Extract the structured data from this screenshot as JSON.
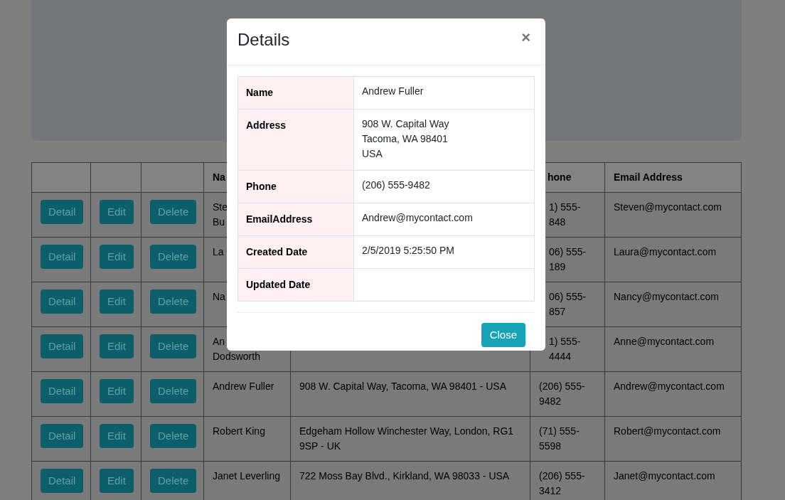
{
  "table": {
    "header": {
      "name": "Na",
      "phone": "hone",
      "email": "Email Address"
    },
    "rows": [
      {
        "kind": "partly_covered",
        "buttons": [
          "Detail",
          "Edit",
          "Delete"
        ],
        "name": "Ste\nBu",
        "phone": "1) 555-\n848",
        "email": "Steven@mycontact.com"
      },
      {
        "kind": "partly_covered",
        "buttons": [
          "Detail",
          "Edit",
          "Delete"
        ],
        "name": "La",
        "phone": "06) 555-\n189",
        "email": "Laura@mycontact.com"
      },
      {
        "kind": "partly_covered",
        "buttons": [
          "Detail",
          "Edit",
          "Delete"
        ],
        "name": "Na",
        "phone": "06) 555-\n857",
        "email": "Nancy@mycontact.com"
      },
      {
        "kind": "partly_covered",
        "buttons": [
          "Detail",
          "Edit",
          "Delete"
        ],
        "name": "An\nDodsworth",
        "phone": "1) 555-\n4444",
        "email": "Anne@mycontact.com"
      },
      {
        "kind": "full",
        "buttons": [
          "Detail",
          "Edit",
          "Delete"
        ],
        "name": "Andrew Fuller",
        "address": "908 W. Capital Way, Tacoma, WA 98401 - USA",
        "phone": "(206) 555-9482",
        "email": "Andrew@mycontact.com"
      },
      {
        "kind": "full",
        "buttons": [
          "Detail",
          "Edit",
          "Delete"
        ],
        "name": "Robert King",
        "address": "Edgeham Hollow Winchester Way, London, RG1 9SP - UK",
        "phone": "(71) 555-5598",
        "email": "Robert@mycontact.com"
      },
      {
        "kind": "full",
        "buttons": [
          "Detail",
          "Edit",
          "Delete"
        ],
        "name": "Janet Leverling",
        "address": "722 Moss Bay Blvd., Kirkland, WA 98033 - USA",
        "phone": "(206) 555-3412",
        "email": "Janet@mycontact.com"
      }
    ]
  },
  "modal": {
    "title": "Details",
    "close_icon": "×",
    "fields": [
      {
        "label": "Name",
        "value": "Andrew Fuller"
      },
      {
        "label": "Address",
        "value": "908 W. Capital Way\nTacoma, WA 98401\nUSA"
      },
      {
        "label": "Phone",
        "value": "(206) 555-9482"
      },
      {
        "label": "EmailAddress",
        "value": "Andrew@mycontact.com"
      },
      {
        "label": "Created Date",
        "value": "2/5/2019 5:25:50 PM"
      },
      {
        "label": "Updated Date"
      }
    ],
    "button": "Close"
  }
}
